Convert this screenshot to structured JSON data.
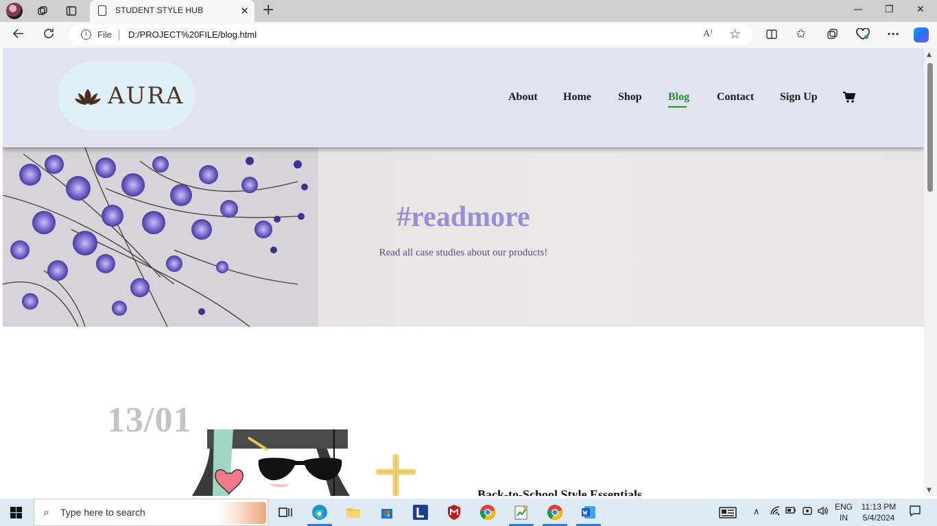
{
  "browser": {
    "tab_title": "STUDENT STYLE HUB",
    "address_scheme": "File",
    "url": "D:/PROJECT%20FILE/blog.html",
    "read_aloud_label": "A⁾"
  },
  "site": {
    "brand": "AURA",
    "nav": {
      "about": "About",
      "home": "Home",
      "shop": "Shop",
      "blog": "Blog",
      "contact": "Contact",
      "signup": "Sign Up"
    },
    "active_nav": "Blog",
    "accent_color": "#2e8b2e",
    "hero": {
      "title": "#readmore",
      "subtitle": "Read all case studies about our products!"
    },
    "post": {
      "date": "13/01",
      "title": "Back-to-School Style Essentials"
    }
  },
  "taskbar": {
    "search_placeholder": "Type here to search",
    "language": "ENG",
    "region": "IN",
    "time": "11:13 PM",
    "date": "5/4/2024"
  }
}
